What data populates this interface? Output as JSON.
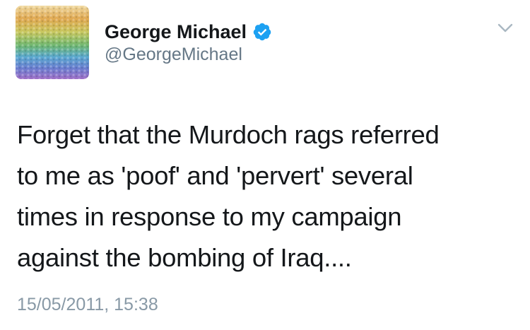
{
  "tweet": {
    "author": {
      "display_name": "George Michael",
      "handle": "@GeorgeMichael",
      "verified": true
    },
    "text": "Forget that the Murdoch rags referred\nto me as 'poof' and 'pervert' several\ntimes in response to my campaign\nagainst the bombing of Iraq....",
    "timestamp": "15/05/2011, 15:38"
  },
  "icons": {
    "verified": "verified-badge-icon",
    "menu": "chevron-down-icon"
  },
  "colors": {
    "text": "#14171a",
    "secondary": "#657786",
    "timestamp": "#8899a6",
    "verified_blue": "#1da1f2",
    "avatar_stripes": [
      "#e8c98a",
      "#d8a85a",
      "#a8c85a",
      "#6ab0c8",
      "#6a8fd0",
      "#9c7ac8"
    ]
  }
}
